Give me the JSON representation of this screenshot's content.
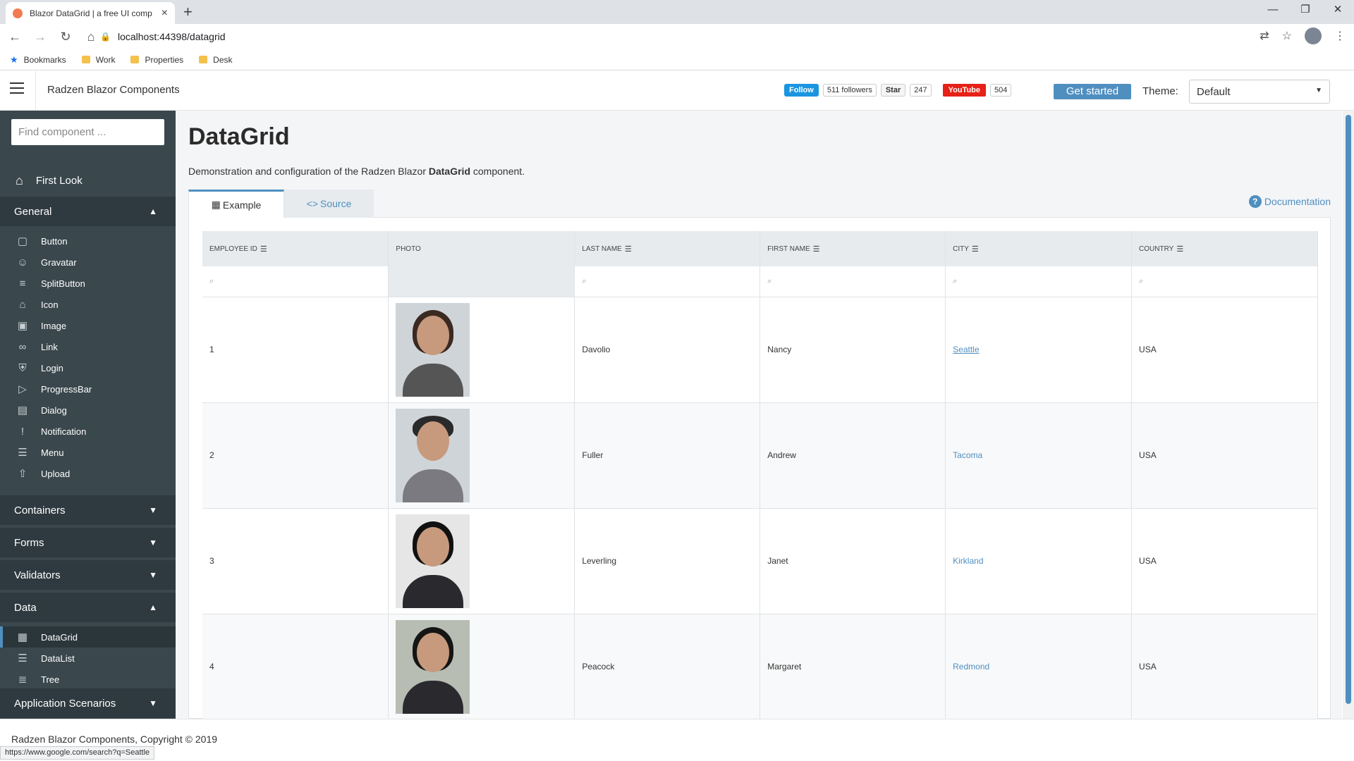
{
  "browser": {
    "tab_title": "Blazor DataGrid | a free UI comp",
    "url": "localhost:44398/datagrid",
    "bookmarks": [
      "Bookmarks",
      "Work",
      "Properties",
      "Desk"
    ],
    "status_url": "https://www.google.com/search?q=Seattle"
  },
  "header": {
    "brand": "Radzen Blazor Components",
    "twitter_label": "Follow",
    "twitter_count": "511 followers",
    "github_label": "Star",
    "github_count": "247",
    "youtube_label": "YouTube",
    "youtube_count": "504",
    "get_started": "Get started",
    "theme_label": "Theme:",
    "theme_value": "Default"
  },
  "sidebar": {
    "search_placeholder": "Find component ...",
    "first_look": "First Look",
    "general": "General",
    "general_items": [
      "Button",
      "Gravatar",
      "SplitButton",
      "Icon",
      "Image",
      "Link",
      "Login",
      "ProgressBar",
      "Dialog",
      "Notification",
      "Menu",
      "Upload"
    ],
    "containers": "Containers",
    "forms": "Forms",
    "validators": "Validators",
    "data": "Data",
    "data_items": [
      "DataGrid",
      "DataList",
      "Tree"
    ],
    "app_scenarios": "Application Scenarios"
  },
  "main": {
    "title": "DataGrid",
    "desc_pre": "Demonstration and configuration of the Radzen Blazor ",
    "desc_bold": "DataGrid",
    "desc_post": " component.",
    "tab_example": "Example",
    "tab_source": "Source",
    "documentation": "Documentation"
  },
  "grid": {
    "columns": [
      "Employee ID",
      "Photo",
      "Last Name",
      "First Name",
      "City",
      "Country"
    ],
    "rows": [
      {
        "id": "1",
        "last": "Davolio",
        "first": "Nancy",
        "city": "Seattle",
        "country": "USA"
      },
      {
        "id": "2",
        "last": "Fuller",
        "first": "Andrew",
        "city": "Tacoma",
        "country": "USA"
      },
      {
        "id": "3",
        "last": "Leverling",
        "first": "Janet",
        "city": "Kirkland",
        "country": "USA"
      },
      {
        "id": "4",
        "last": "Peacock",
        "first": "Margaret",
        "city": "Redmond",
        "country": "USA"
      }
    ]
  },
  "footer": {
    "copyright": "Radzen Blazor Components, Copyright © 2019"
  }
}
